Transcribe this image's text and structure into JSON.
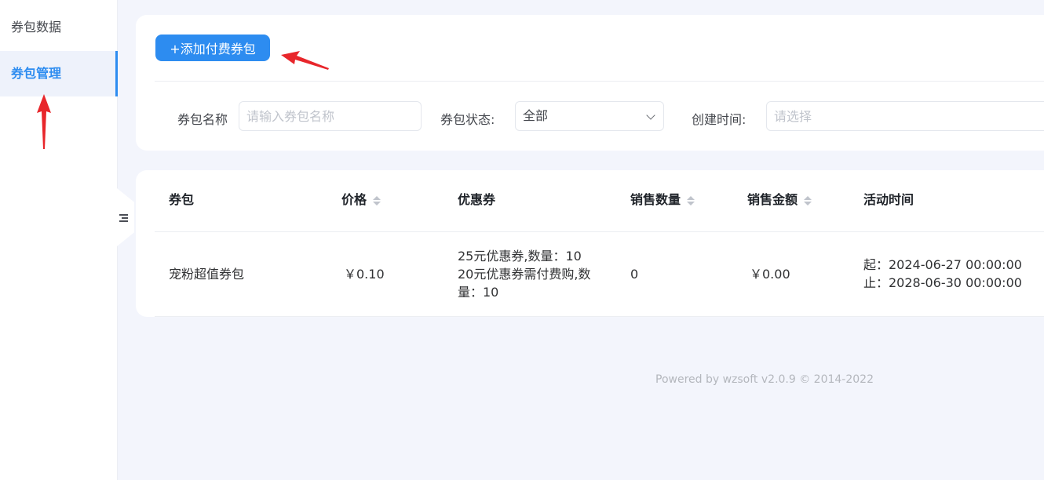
{
  "sidebar": {
    "items": [
      {
        "label": "券包数据",
        "active": false
      },
      {
        "label": "券包管理",
        "active": true
      }
    ]
  },
  "toolbar": {
    "add_label": "+添加付费券包"
  },
  "filters": {
    "name_label": "券包名称",
    "name_placeholder": "请输入券包名称",
    "status_label": "券包状态:",
    "status_value": "全部",
    "time_label": "创建时间:",
    "time_placeholder": "请选择"
  },
  "table": {
    "headers": [
      "券包",
      "价格",
      "优惠券",
      "销售数量",
      "销售金额",
      "活动时间"
    ],
    "rows": [
      {
        "name": "宠粉超值券包",
        "price": "￥0.10",
        "coupon_line1": "25元优惠券,数量：10",
        "coupon_line2": "20元优惠券需付费购,数",
        "coupon_line3": "量：10",
        "sales_count": "0",
        "sales_amount": "￥0.00",
        "start": "起：2024-06-27 00:00:00",
        "end": "止：2028-06-30 00:00:00"
      }
    ]
  },
  "footer": {
    "text": "Powered by wzsoft v2.0.9 © 2014-2022"
  },
  "colors": {
    "accent": "#2d8cf0",
    "annotation_arrow": "#e8262b",
    "background": "#f3f5fc"
  },
  "icons": {
    "collapse": "collapse-menu-icon",
    "dropdown": "chevron-down-icon",
    "sort": "sort-caret-icon"
  }
}
